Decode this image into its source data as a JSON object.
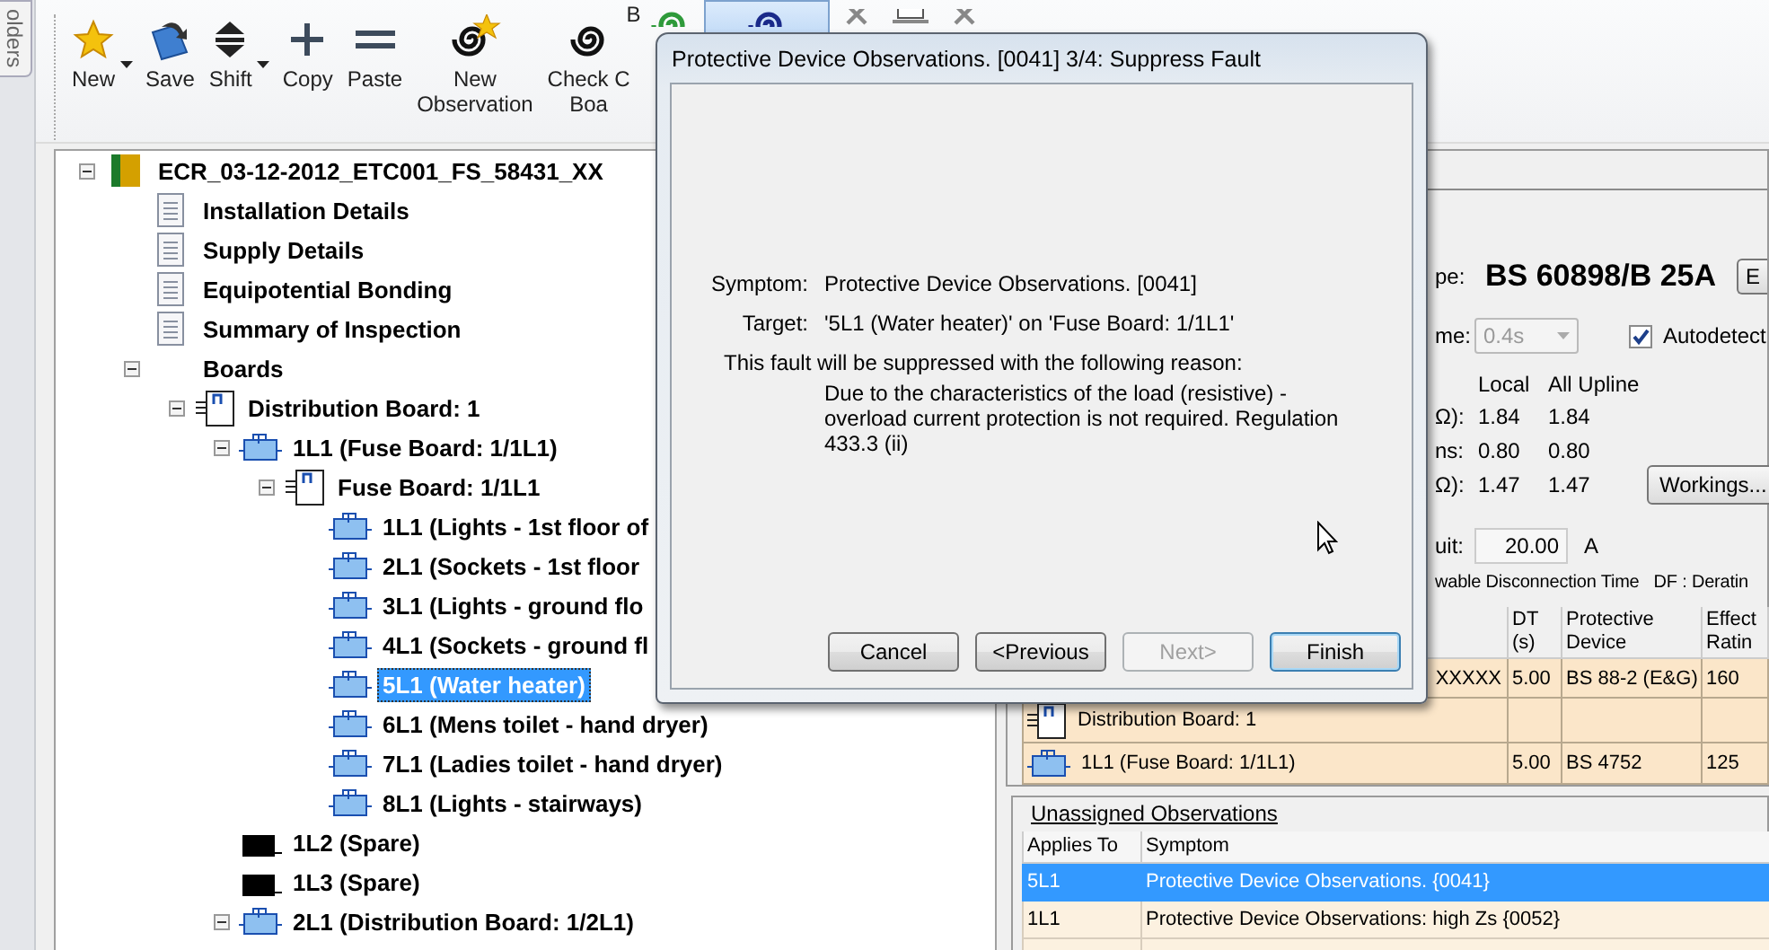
{
  "side_tab": {
    "label": "olders"
  },
  "toolbar": {
    "buttons": [
      {
        "kind": "star",
        "lines": [
          "New"
        ],
        "dropdown": true,
        "pressed": false
      },
      {
        "kind": "save",
        "lines": [
          "Save"
        ],
        "dropdown": false,
        "pressed": false
      },
      {
        "kind": "shift",
        "lines": [
          "Shift"
        ],
        "dropdown": true,
        "pressed": false
      },
      {
        "kind": "plus",
        "lines": [
          "Copy"
        ],
        "dropdown": false,
        "pressed": false
      },
      {
        "kind": "equals",
        "lines": [
          "Paste"
        ],
        "dropdown": false,
        "pressed": false
      },
      {
        "kind": "spiral-star",
        "lines": [
          "New",
          "Observation"
        ],
        "dropdown": false,
        "pressed": false
      },
      {
        "kind": "spiral-badge",
        "badge": "B",
        "lines": [
          "Check C",
          "Boa"
        ],
        "dropdown": false,
        "pressed": false
      },
      {
        "kind": "spiral-green",
        "dropdown": false,
        "pressed": false
      },
      {
        "kind": "spiral-blue",
        "dropdown": false,
        "pressed": true
      },
      {
        "kind": "cross",
        "dropdown": false,
        "pressed": false
      },
      {
        "kind": "frame",
        "dropdown": false,
        "pressed": false
      },
      {
        "kind": "cross",
        "dropdown": false,
        "pressed": false
      }
    ]
  },
  "tree": {
    "nodes": [
      {
        "label": "ECR_03-12-2012_ETC001_FS_58431_XX",
        "kind": "root",
        "expanded": true,
        "selected": false,
        "children": [
          {
            "label": "Installation Details",
            "kind": "page",
            "selected": false
          },
          {
            "label": "Supply Details",
            "kind": "page",
            "selected": false
          },
          {
            "label": "Equipotential Bonding",
            "kind": "page",
            "selected": false
          },
          {
            "label": "Summary of Inspection",
            "kind": "page",
            "selected": false
          },
          {
            "label": "Boards",
            "kind": "group",
            "expanded": true,
            "selected": false,
            "children": [
              {
                "label": "Distribution Board: 1",
                "kind": "board",
                "expanded": true,
                "selected": false,
                "children": [
                  {
                    "label": "1L1 (Fuse Board: 1/1L1)",
                    "kind": "circuit",
                    "expanded": true,
                    "selected": false,
                    "children": [
                      {
                        "label": "Fuse Board: 1/1L1",
                        "kind": "board",
                        "expanded": true,
                        "selected": false,
                        "children": [
                          {
                            "label": "1L1 (Lights - 1st floor of",
                            "kind": "circuit",
                            "selected": false
                          },
                          {
                            "label": "2L1 (Sockets - 1st floor",
                            "kind": "circuit",
                            "selected": false
                          },
                          {
                            "label": "3L1 (Lights - ground flo",
                            "kind": "circuit",
                            "selected": false
                          },
                          {
                            "label": "4L1 (Sockets - ground fl",
                            "kind": "circuit",
                            "selected": false
                          },
                          {
                            "label": "5L1 (Water heater)",
                            "kind": "circuit",
                            "selected": true
                          },
                          {
                            "label": "6L1 (Mens toilet - hand dryer)",
                            "kind": "circuit",
                            "selected": false
                          },
                          {
                            "label": "7L1 (Ladies toilet - hand dryer)",
                            "kind": "circuit",
                            "selected": false
                          },
                          {
                            "label": "8L1 (Lights - stairways)",
                            "kind": "circuit",
                            "selected": false
                          }
                        ]
                      }
                    ]
                  },
                  {
                    "label": "1L2 (Spare)",
                    "kind": "spare",
                    "selected": false
                  },
                  {
                    "label": "1L3 (Spare)",
                    "kind": "spare",
                    "selected": false
                  },
                  {
                    "label": "2L1 (Distribution Board: 1/2L1)",
                    "kind": "circuit",
                    "expanded": true,
                    "selected": false
                  }
                ]
              }
            ]
          }
        ]
      }
    ]
  },
  "properties": {
    "device_type": {
      "label": "pe:",
      "value": "BS 60898/B 25A",
      "button": "E"
    },
    "disconnection_time": {
      "label": "me:",
      "value": "0.4s",
      "disabled": true
    },
    "autodetect": {
      "label": "Autodetect",
      "checked": true
    },
    "readings": {
      "columns": [
        "Local",
        "All Upline"
      ],
      "rows": [
        {
          "label": "Ω):",
          "values": [
            "1.84",
            "1.84"
          ]
        },
        {
          "label": "ns:",
          "values": [
            "0.80",
            "0.80"
          ]
        },
        {
          "label": "Ω):",
          "values": [
            "1.47",
            "1.47"
          ]
        }
      ]
    },
    "workings_button": "Workings...",
    "circuit": {
      "label": "uit:",
      "value": "20.00",
      "unit": "A"
    },
    "legend": [
      "wable Disconnection Time",
      "DF : Deratin"
    ],
    "table": {
      "columns": [
        {
          "lines": [
            "DT",
            "(s)"
          ]
        },
        {
          "lines": [
            "Protective",
            "Device"
          ]
        },
        {
          "lines": [
            "Effect",
            "Ratin"
          ]
        }
      ],
      "rows": [
        {
          "kind": "plain",
          "name": "XXXXX",
          "dt": "5.00",
          "device": "BS 88-2 (E&G)",
          "rating": "160"
        },
        {
          "kind": "board",
          "name": "Distribution Board: 1"
        },
        {
          "kind": "circuit",
          "name": "1L1 (Fuse Board: 1/1L1)",
          "dt": "5.00",
          "device": "BS 4752",
          "rating": "125"
        }
      ]
    }
  },
  "observations": {
    "title": "Unassigned Observations",
    "columns": [
      "Applies To",
      "Symptom"
    ],
    "rows": [
      {
        "applies_to": "5L1",
        "symptom": "Protective Device Observations. {0041}",
        "selected": true
      },
      {
        "applies_to": "1L1",
        "symptom": "Protective Device Observations: high Zs {0052}",
        "selected": false
      }
    ]
  },
  "dialog": {
    "title": "Protective Device Observations. [0041] 3/4: Suppress Fault",
    "symptom": {
      "label": "Symptom:",
      "value": "Protective Device Observations. [0041]"
    },
    "target": {
      "label": "Target:",
      "value": "'5L1 (Water heater)' on 'Fuse Board: 1/1L1'"
    },
    "message": "This fault will be suppressed with the following reason:",
    "reason": "Due to the characteristics of the load (resistive) - overload current protection is not required. Regulation 433.3 (ii)",
    "buttons": [
      {
        "label": "Cancel",
        "disabled": false,
        "default": false
      },
      {
        "label": "<Previous",
        "disabled": false,
        "default": false
      },
      {
        "label": "Next>",
        "disabled": true,
        "default": false
      },
      {
        "label": "Finish",
        "disabled": false,
        "default": true
      }
    ]
  }
}
